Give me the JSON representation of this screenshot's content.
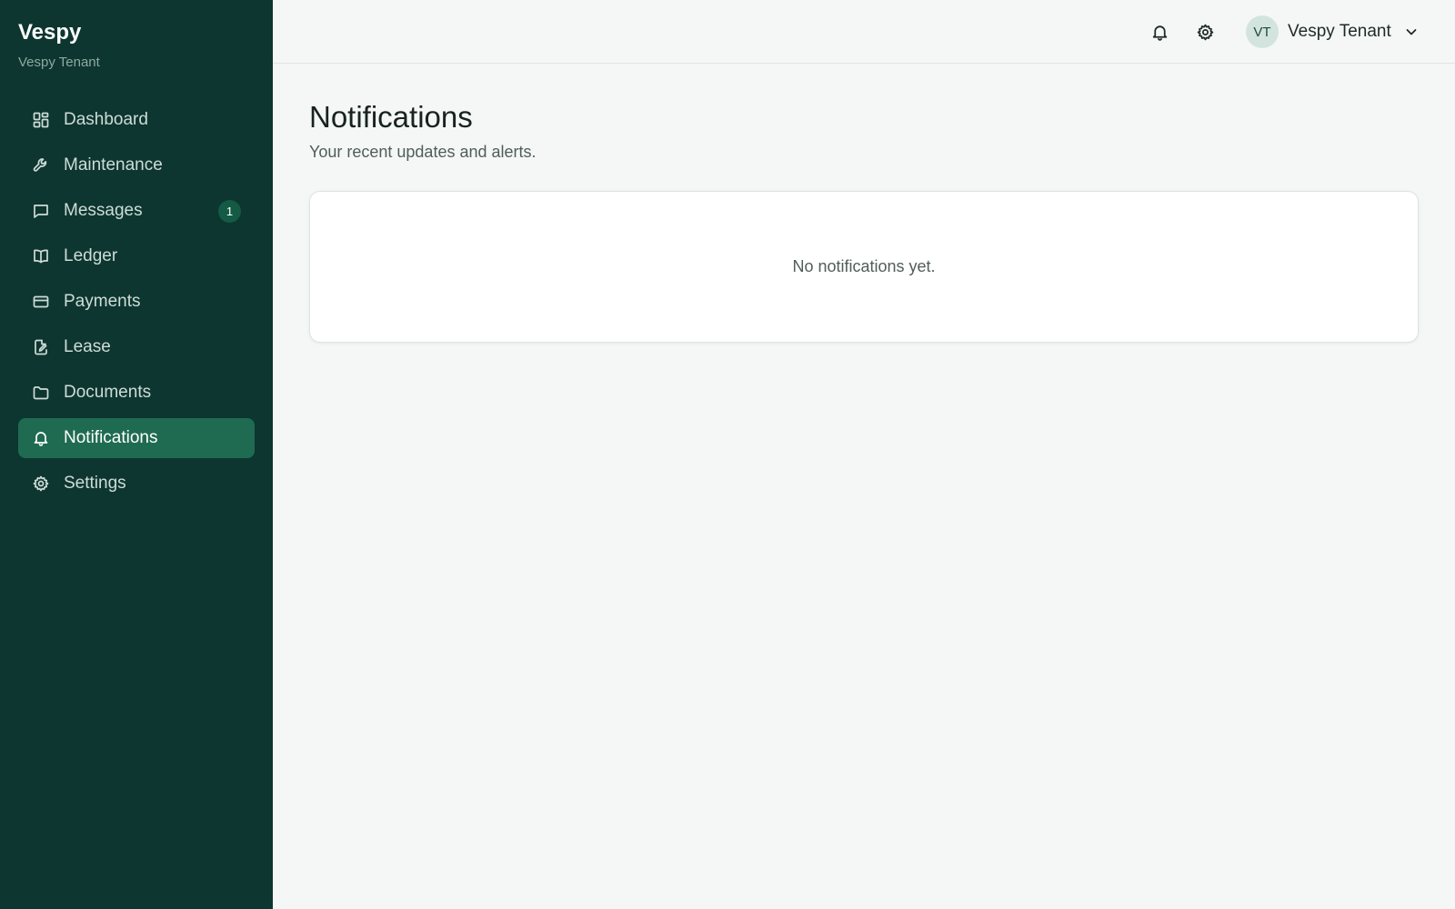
{
  "brand": {
    "title": "Vespy",
    "subtitle": "Vespy Tenant"
  },
  "sidebar": {
    "items": [
      {
        "label": "Dashboard",
        "icon": "dashboard-icon",
        "active": false
      },
      {
        "label": "Maintenance",
        "icon": "wrench-icon",
        "active": false
      },
      {
        "label": "Messages",
        "icon": "message-icon",
        "active": false,
        "badge": "1"
      },
      {
        "label": "Ledger",
        "icon": "book-icon",
        "active": false
      },
      {
        "label": "Payments",
        "icon": "credit-card-icon",
        "active": false
      },
      {
        "label": "Lease",
        "icon": "file-edit-icon",
        "active": false
      },
      {
        "label": "Documents",
        "icon": "folder-icon",
        "active": false
      },
      {
        "label": "Notifications",
        "icon": "bell-icon",
        "active": true
      },
      {
        "label": "Settings",
        "icon": "gear-icon",
        "active": false
      }
    ]
  },
  "topbar": {
    "icons": [
      "bell-icon",
      "gear-icon"
    ],
    "user": {
      "initials": "VT",
      "name": "Vespy Tenant"
    }
  },
  "main": {
    "title": "Notifications",
    "subtitle": "Your recent updates and alerts.",
    "empty_message": "No notifications yet."
  },
  "colors": {
    "sidebar_bg": "#0d3630",
    "active_item_bg": "#1f6b52",
    "badge_bg": "#145a44",
    "page_bg": "#f5f7f6",
    "avatar_bg": "#d3e4de"
  }
}
